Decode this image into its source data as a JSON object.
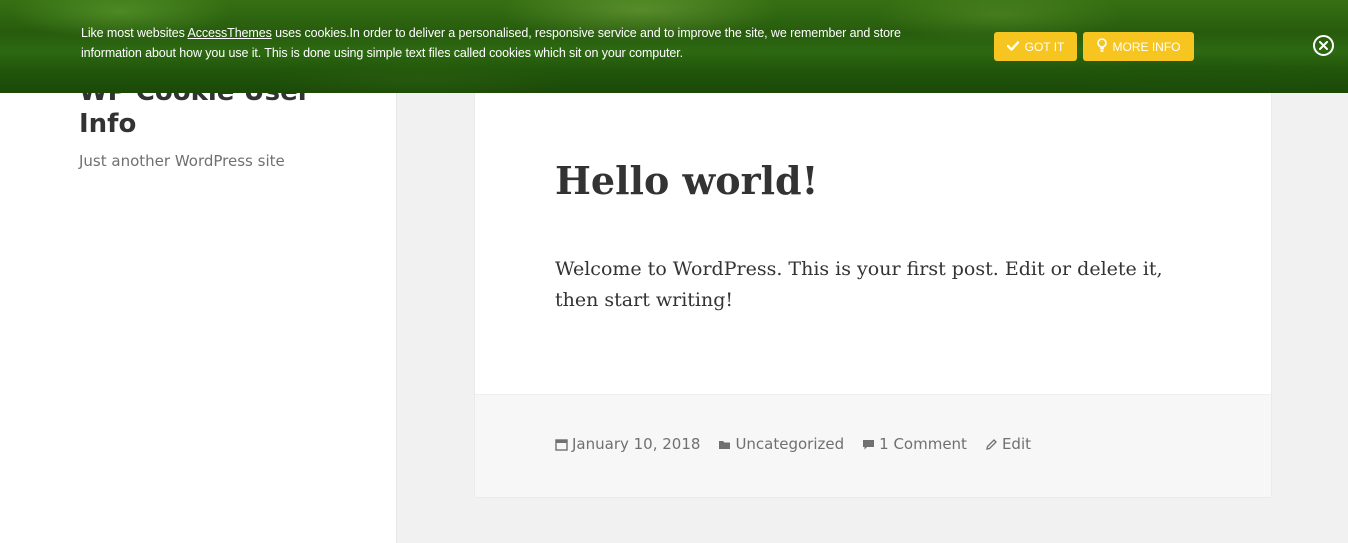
{
  "site": {
    "title": "WP Cookie User Info",
    "tagline": "Just another WordPress site"
  },
  "post": {
    "title": "Hello world!",
    "content": "Welcome to WordPress. This is your first post. Edit or delete it, then start writing!",
    "meta": {
      "date": "January 10, 2018",
      "category": "Uncategorized",
      "comments": "1 Comment",
      "edit": "Edit"
    }
  },
  "cookie_banner": {
    "text_before_link": "Like most websites ",
    "link_text": "AccessThemes",
    "text_after_link": " uses cookies.In order to deliver a personalised, responsive service and to improve the site, we remember and store information about how you use it. This is done using simple text files called cookies which sit on your computer.",
    "got_it_label": "GOT IT",
    "more_info_label": "MORE INFO",
    "button_color": "#f6c51f"
  },
  "icons": {
    "date": "calendar-icon",
    "category": "folder-icon",
    "comments": "comment-icon",
    "edit": "pencil-icon",
    "got_it": "checkmark-icon",
    "more_info": "lightbulb-icon",
    "close": "close-icon"
  }
}
